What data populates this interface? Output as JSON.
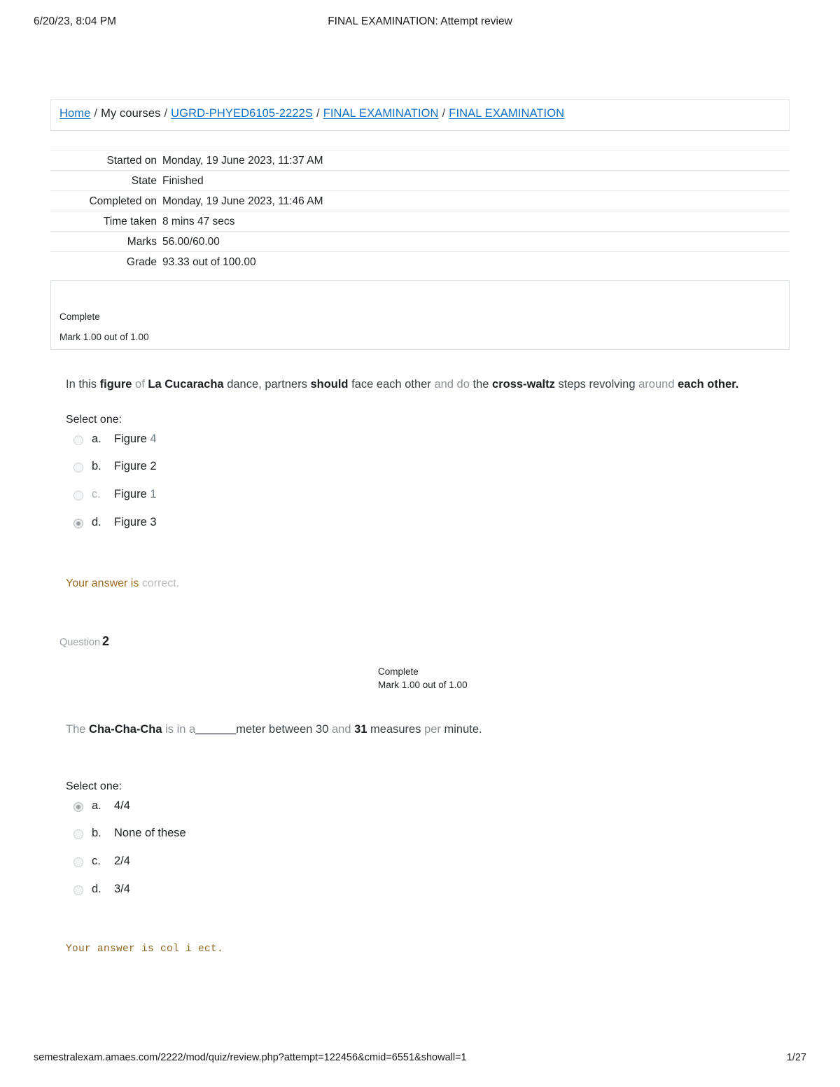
{
  "print_header": {
    "date": "6/20/23, 8:04 PM",
    "title": "FINAL EXAMINATION: Attempt review"
  },
  "breadcrumb": {
    "items": [
      {
        "label": "Home",
        "link": true
      },
      {
        "label": "My courses",
        "link": false
      },
      {
        "label": "UGRD-PHYED6105-2222S",
        "link": true
      },
      {
        "label": "FINAL EXAMINATION",
        "link": true
      },
      {
        "label": "FINAL EXAMINATION",
        "link": true
      }
    ],
    "separator": "/"
  },
  "summary": {
    "rows": [
      {
        "key": "Started on",
        "value": "Monday, 19 June 2023, 11:37 AM"
      },
      {
        "key": "State",
        "value": "Finished"
      },
      {
        "key": "Completed on",
        "value": "Monday, 19 June 2023, 11:46 AM"
      },
      {
        "key": "Time taken",
        "value": "8 mins 47 secs"
      },
      {
        "key": "Marks",
        "value": "56.00/60.00"
      },
      {
        "key": "Grade",
        "value": "93.33 out of 100.00"
      }
    ]
  },
  "question1": {
    "state": "Complete",
    "mark": "Mark 1.00 out of 1.00",
    "text_parts": {
      "p1": "In this ",
      "p2": "figure",
      "p3": " of ",
      "p4": "La Cucaracha",
      "p5": " dance, partners ",
      "p6": "should",
      "p7": " face each other ",
      "p8": "and do",
      "p9": " the ",
      "p10": "cross-waltz",
      "p11": " steps revolving ",
      "p12": "around",
      "p13": " ",
      "p14": "each other."
    },
    "select_one": "Select one:",
    "options": [
      {
        "letter": "a.",
        "text": "Figure ",
        "suffix": "4",
        "checked": false,
        "faint_letter": false,
        "faint_suffix": true
      },
      {
        "letter": "b.",
        "text": "Figure ",
        "suffix": "2",
        "checked": false,
        "faint_letter": false,
        "faint_suffix": false
      },
      {
        "letter": "c.",
        "text": "Figure ",
        "suffix": "1",
        "checked": false,
        "faint_letter": true,
        "faint_suffix": true
      },
      {
        "letter": "d.",
        "text": "Figure ",
        "suffix": "3",
        "checked": true,
        "faint_letter": false,
        "faint_suffix": false
      }
    ],
    "feedback_main": "Your answer is",
    "feedback_tail": " correct."
  },
  "question2": {
    "question_word": "Question",
    "question_number": "2",
    "state": "Complete",
    "mark": "Mark 1.00 out of 1.00",
    "text_parts": {
      "p1": "The ",
      "p2": "Cha-Cha-Cha",
      "p3": " is in a",
      "p4": "______",
      "p5": "meter between ",
      "p6": "30",
      "p7": " and ",
      "p8": "31",
      "p9": " measures ",
      "p10": "per",
      "p11": " minute."
    },
    "select_one": "Select one:",
    "options": [
      {
        "letter": "a.",
        "text": "4/4",
        "checked": true
      },
      {
        "letter": "b.",
        "text": "None of these",
        "checked": false
      },
      {
        "letter": "c.",
        "text": "2/4",
        "checked": false
      },
      {
        "letter": "d.",
        "text": "3/4",
        "checked": false
      }
    ],
    "feedback": "Your answer is col i ect."
  },
  "print_footer": {
    "url": "semestralexam.amaes.com/2222/mod/quiz/review.php?attempt=122456&cmid=6551&showall=1",
    "page": "1/27"
  },
  "colors": {
    "link": "#0f6fc5",
    "feedback": "#9b6a20",
    "border": "#e6eaee"
  }
}
